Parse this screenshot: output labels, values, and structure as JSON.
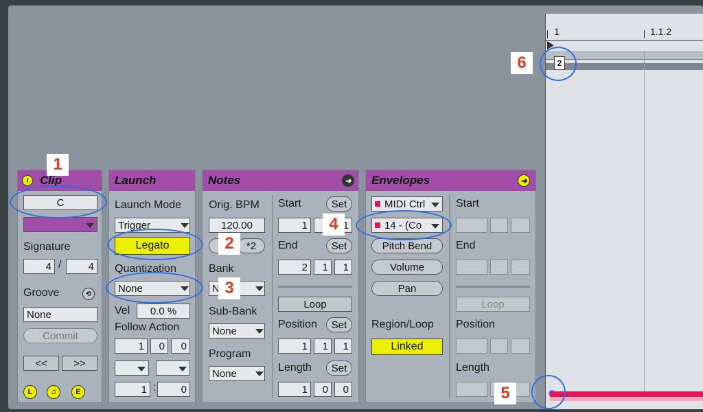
{
  "clip": {
    "title": "Clip",
    "name": "C",
    "signature_label": "Signature",
    "sig_num": "4",
    "sig_slash": "/",
    "sig_den": "4",
    "groove_label": "Groove",
    "groove_value": "None",
    "commit_label": "Commit",
    "prev_label": "<<",
    "next_label": ">>",
    "bottom_icons": [
      "L",
      "♫",
      "E"
    ]
  },
  "launch": {
    "title": "Launch",
    "mode_label": "Launch Mode",
    "mode_value": "Trigger",
    "legato_label": "Legato",
    "quant_label": "Quantization",
    "quant_value": "None",
    "vel_label": "Vel",
    "vel_value": "0.0 %",
    "follow_label": "Follow Action",
    "follow_a": "1",
    "follow_b": "0",
    "follow_c": "0",
    "chance_a": "1",
    "chance_sep": ":",
    "chance_b": "0"
  },
  "notes": {
    "title": "Notes",
    "bpm_label": "Orig. BPM",
    "bpm_value": "120.00",
    "half_label": ":2",
    "double_label": "*2",
    "bank_label": "Bank",
    "bank_value": "N",
    "subbank_label": "Sub-Bank",
    "subbank_value": "None",
    "program_label": "Program",
    "program_value": "None",
    "start_label": "Start",
    "start_values": [
      "1",
      "1",
      "1"
    ],
    "end_label": "End",
    "end_values": [
      "2",
      "1",
      "1"
    ],
    "set_label": "Set",
    "loop_label": "Loop",
    "position_label": "Position",
    "position_values": [
      "1",
      "1",
      "1"
    ],
    "length_label": "Length",
    "length_values": [
      "1",
      "0",
      "0"
    ]
  },
  "envelopes": {
    "title": "Envelopes",
    "device_value": "MIDI Ctrl",
    "control_value": "14 - (Co",
    "pitch_bend": "Pitch Bend",
    "volume": "Volume",
    "pan": "Pan",
    "region_label": "Region/Loop",
    "linked_label": "Linked",
    "start_label": "Start",
    "end_label": "End",
    "loop_label": "Loop",
    "position_label": "Position",
    "length_label": "Length"
  },
  "editor": {
    "ruler_1": "1",
    "ruler_2": "1.1.2",
    "marker_label": "2"
  },
  "annotations": [
    "1",
    "2",
    "3",
    "4",
    "5",
    "6"
  ],
  "colors": {
    "header": "#a24ea9",
    "accent_yellow": "#eaf000",
    "annotation_red": "#e03b20",
    "ring_blue": "#2f6fe0",
    "envelope_pink": "#e0155a"
  }
}
